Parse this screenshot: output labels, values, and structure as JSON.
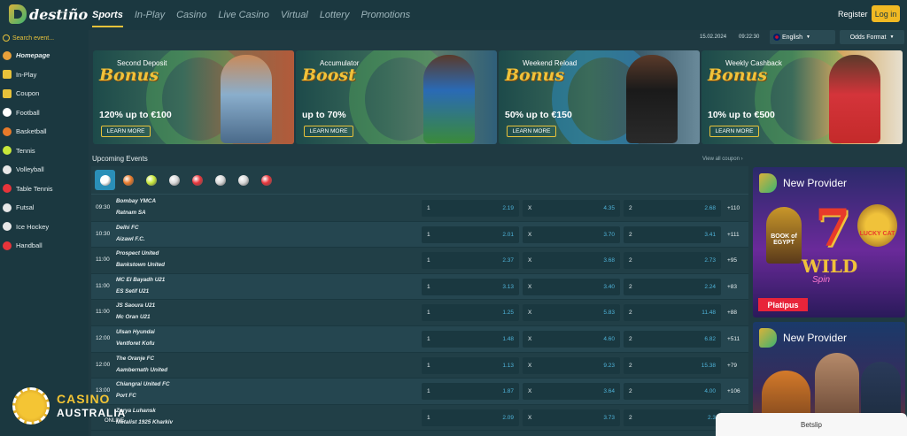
{
  "header": {
    "logo_text": "destiño",
    "nav": [
      "Sports",
      "In-Play",
      "Casino",
      "Live Casino",
      "Virtual",
      "Lottery",
      "Promotions"
    ],
    "register": "Register",
    "login": "Log in"
  },
  "toolbar": {
    "date": "15.02.2024",
    "time": "09:22:30",
    "language": "English",
    "odds_format": "Odds Format"
  },
  "sidebar": {
    "search_placeholder": "Search event...",
    "items": [
      {
        "label": "Homepage",
        "icon": "home-icon",
        "color": "#e8a03a"
      },
      {
        "label": "In-Play",
        "icon": "play-icon",
        "color": "#e8c23a"
      },
      {
        "label": "Coupon",
        "icon": "coupon-icon",
        "color": "#e8c23a"
      },
      {
        "label": "Football",
        "icon": "football-icon",
        "color": "#ffffff"
      },
      {
        "label": "Basketball",
        "icon": "basketball-icon",
        "color": "#e87a2a"
      },
      {
        "label": "Tennis",
        "icon": "tennis-icon",
        "color": "#c8e83a"
      },
      {
        "label": "Volleyball",
        "icon": "volleyball-icon",
        "color": "#e8e8e8"
      },
      {
        "label": "Table Tennis",
        "icon": "table-tennis-icon",
        "color": "#e8343a"
      },
      {
        "label": "Futsal",
        "icon": "futsal-icon",
        "color": "#e8e8e8"
      },
      {
        "label": "Ice Hockey",
        "icon": "ice-hockey-icon",
        "color": "#e8e8e8"
      },
      {
        "label": "Handball",
        "icon": "handball-icon",
        "color": "#e8343a"
      }
    ]
  },
  "banners": [
    {
      "sub": "Second Deposit",
      "big": "Bonus",
      "offer": "120% up to €100",
      "button": "LEARN MORE"
    },
    {
      "sub": "Accumulator",
      "big": "Boost",
      "offer": "up to 70%",
      "button": "LEARN MORE"
    },
    {
      "sub": "Weekend Reload",
      "big": "Bonus",
      "offer": "50% up to €150",
      "button": "LEARN MORE"
    },
    {
      "sub": "Weekly Cashback",
      "big": "Bonus",
      "offer": "10% up to €500",
      "button": "LEARN MORE"
    }
  ],
  "events": {
    "title": "Upcoming Events",
    "view_all": "View all coupon",
    "sport_tabs": [
      {
        "icon": "football-icon",
        "color": "#ffffff"
      },
      {
        "icon": "basketball-icon",
        "color": "#e87a2a"
      },
      {
        "icon": "tennis-icon",
        "color": "#c8e83a"
      },
      {
        "icon": "volleyball-icon",
        "color": "#d8d8d8"
      },
      {
        "icon": "table-tennis-icon",
        "color": "#e8343a"
      },
      {
        "icon": "futsal-icon",
        "color": "#d8d8d8"
      },
      {
        "icon": "ice-hockey-icon",
        "color": "#d8d8d8"
      },
      {
        "icon": "handball-icon",
        "color": "#e8343a"
      }
    ],
    "rows": [
      {
        "time": "09:30",
        "home": "Bombay YMCA",
        "away": "Ratnam SA",
        "o1": "2.19",
        "ox": "4.35",
        "o2": "2.68",
        "more": "+110"
      },
      {
        "time": "10:30",
        "home": "Delhi FC",
        "away": "Aizawl F.C.",
        "o1": "2.01",
        "ox": "3.70",
        "o2": "3.41",
        "more": "+111"
      },
      {
        "time": "11:00",
        "home": "Prospect United",
        "away": "Bankstown United",
        "o1": "2.37",
        "ox": "3.68",
        "o2": "2.73",
        "more": "+95"
      },
      {
        "time": "11:00",
        "home": "MC El Bayadh U21",
        "away": "ES Setif U21",
        "o1": "3.13",
        "ox": "3.40",
        "o2": "2.24",
        "more": "+83"
      },
      {
        "time": "11:00",
        "home": "JS Saoura U21",
        "away": "Mc Oran U21",
        "o1": "1.25",
        "ox": "5.83",
        "o2": "11.48",
        "more": "+88"
      },
      {
        "time": "12:00",
        "home": "Ulsan Hyundai",
        "away": "Ventforet Kofu",
        "o1": "1.48",
        "ox": "4.60",
        "o2": "6.82",
        "more": "+511"
      },
      {
        "time": "12:00",
        "home": "The Oranje FC",
        "away": "Aambernath United",
        "o1": "1.13",
        "ox": "9.23",
        "o2": "15.38",
        "more": "+79"
      },
      {
        "time": "13:00",
        "home": "Chiangrai United FC",
        "away": "Port FC",
        "o1": "1.87",
        "ox": "3.64",
        "o2": "4.00",
        "more": "+106"
      },
      {
        "time": "",
        "home": "Zorya Luhansk",
        "away": "Metalist 1925 Kharkiv",
        "o1": "2.09",
        "ox": "3.73",
        "o2": "2.3",
        "more": ""
      }
    ],
    "label_1": "1",
    "label_x": "X",
    "label_2": "2"
  },
  "promos": [
    {
      "title": "New Provider",
      "game_left": "BOOK of EGYPT",
      "game_center": "7",
      "wild": "WILD",
      "spin": "Spin",
      "game_right": "LUCKY CAT",
      "badge": "Platipus"
    },
    {
      "title": "New Provider"
    }
  ],
  "watermark": {
    "line1": "CASINO",
    "line2": "AUSTRALIA",
    "line3": "ONLINE"
  },
  "betslip": "Betslip"
}
